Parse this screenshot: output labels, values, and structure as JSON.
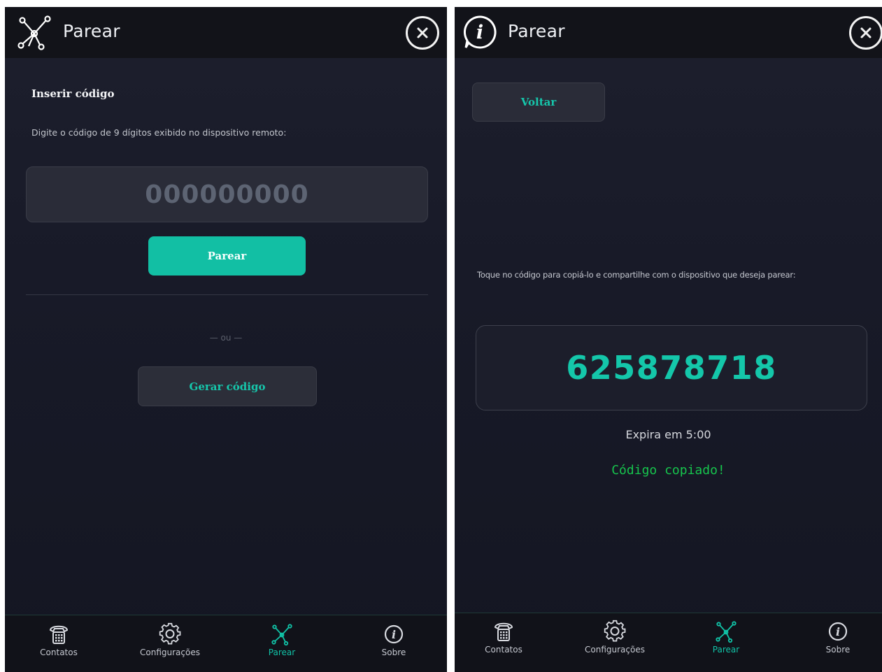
{
  "colors": {
    "accent": "#12bfa4",
    "success": "#16c44d",
    "background": "#181a28",
    "header": "#121319"
  },
  "left": {
    "header": {
      "icon": "network-icon",
      "title": "Parear",
      "close_icon": "close-icon"
    },
    "section_title": "Inserir código",
    "instruction": "Digite o código de 9 dígitos exibido no dispositivo remoto:",
    "code_input": {
      "value": "",
      "placeholder": "000000000"
    },
    "pair_button": "Parear",
    "or_text": "— ou —",
    "generate_button": "Gerar código"
  },
  "right": {
    "header": {
      "icon": "info-icon",
      "title": "Parear",
      "close_icon": "close-icon"
    },
    "back_button": "Voltar",
    "instruction": "Toque no código para copiá-lo e compartilhe com o dispositivo que deseja parear:",
    "code": "625878718",
    "expiry": "Expira em 5:00",
    "copied": "Código copiado!"
  },
  "nav": {
    "items": [
      {
        "label": "Contatos",
        "icon": "phone-icon",
        "active": false
      },
      {
        "label": "Configurações",
        "icon": "gear-icon",
        "active": false
      },
      {
        "label": "Parear",
        "icon": "network-icon",
        "active": true
      },
      {
        "label": "Sobre",
        "icon": "info-icon",
        "active": false
      }
    ]
  }
}
